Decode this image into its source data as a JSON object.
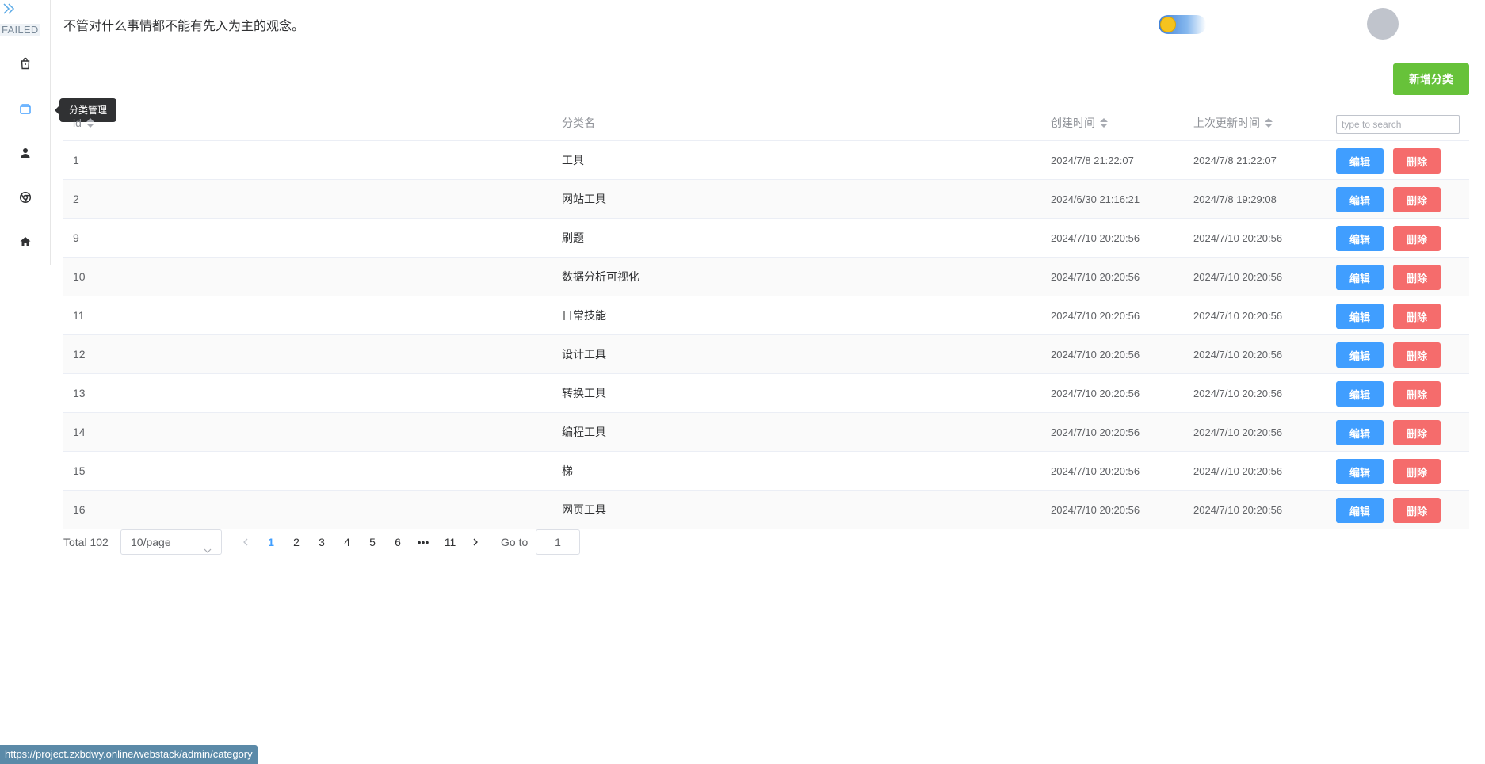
{
  "sidebar": {
    "status_label": "FAILED",
    "items": [
      {
        "icon": "shopping-bag-icon"
      },
      {
        "icon": "category-icon",
        "active": true
      },
      {
        "icon": "user-icon"
      },
      {
        "icon": "chrome-icon"
      },
      {
        "icon": "home-icon"
      }
    ],
    "tooltip": "分类管理"
  },
  "header": {
    "motto": "不管对什么事情都不能有先入为主的观念。"
  },
  "toolbar": {
    "add_label": "新增分类"
  },
  "table": {
    "columns": {
      "id": "id",
      "name": "分类名",
      "created": "创建时间",
      "updated": "上次更新时间"
    },
    "search_placeholder": "type to search",
    "edit_label": "编辑",
    "delete_label": "删除",
    "rows": [
      {
        "id": "1",
        "name": "工具",
        "created": "2024/7/8 21:22:07",
        "updated": "2024/7/8 21:22:07"
      },
      {
        "id": "2",
        "name": "网站工具",
        "created": "2024/6/30 21:16:21",
        "updated": "2024/7/8 19:29:08"
      },
      {
        "id": "9",
        "name": "刷题",
        "created": "2024/7/10 20:20:56",
        "updated": "2024/7/10 20:20:56"
      },
      {
        "id": "10",
        "name": "数据分析可视化",
        "created": "2024/7/10 20:20:56",
        "updated": "2024/7/10 20:20:56"
      },
      {
        "id": "11",
        "name": "日常技能",
        "created": "2024/7/10 20:20:56",
        "updated": "2024/7/10 20:20:56"
      },
      {
        "id": "12",
        "name": "设计工具",
        "created": "2024/7/10 20:20:56",
        "updated": "2024/7/10 20:20:56"
      },
      {
        "id": "13",
        "name": "转换工具",
        "created": "2024/7/10 20:20:56",
        "updated": "2024/7/10 20:20:56"
      },
      {
        "id": "14",
        "name": "编程工具",
        "created": "2024/7/10 20:20:56",
        "updated": "2024/7/10 20:20:56"
      },
      {
        "id": "15",
        "name": "梯",
        "created": "2024/7/10 20:20:56",
        "updated": "2024/7/10 20:20:56"
      },
      {
        "id": "16",
        "name": "网页工具",
        "created": "2024/7/10 20:20:56",
        "updated": "2024/7/10 20:20:56"
      }
    ]
  },
  "pagination": {
    "total": "Total 102",
    "page_size": "10/page",
    "pages": [
      "1",
      "2",
      "3",
      "4",
      "5",
      "6",
      "•••",
      "11"
    ],
    "current": "1",
    "goto_label": "Go to",
    "goto_value": "1"
  },
  "status_url": "https://project.zxbdwy.online/webstack/admin/category",
  "colors": {
    "primary": "#409eff",
    "success": "#67c23a",
    "danger": "#f56c6c"
  }
}
